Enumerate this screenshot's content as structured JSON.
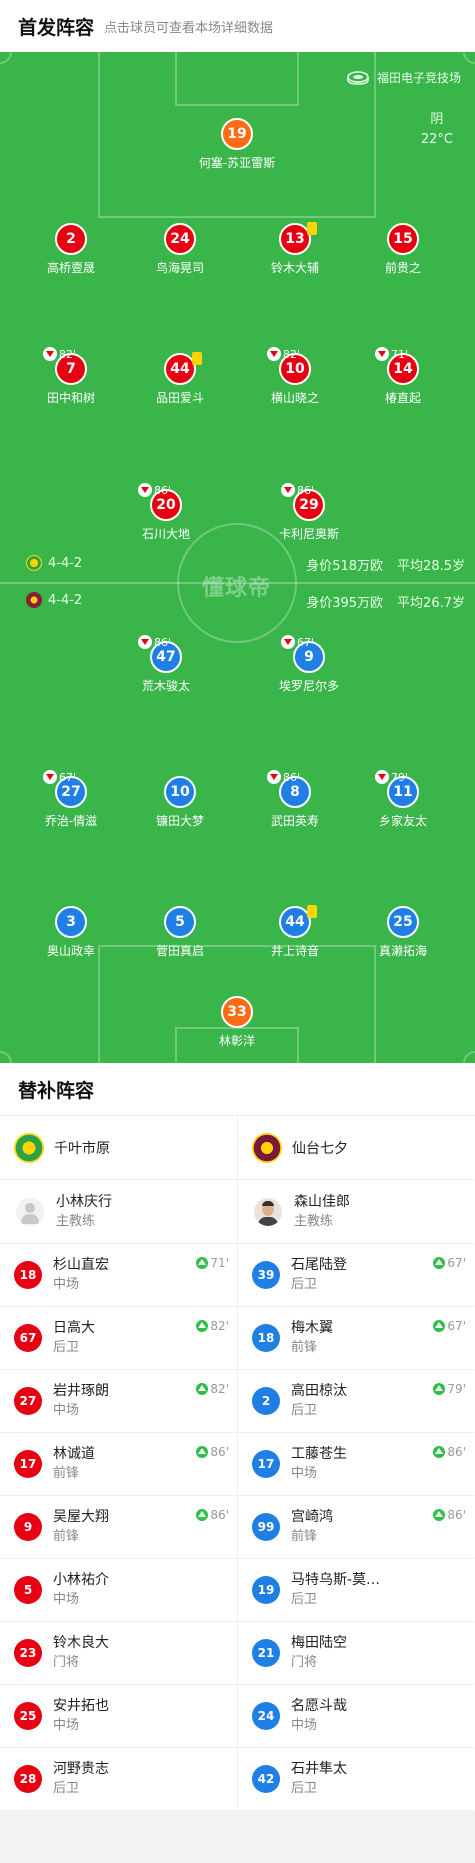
{
  "header": {
    "title": "首发阵容",
    "subtitle": "点击球员可查看本场详细数据"
  },
  "pitch": {
    "venue": "福田电子竞技场",
    "weather": "阴",
    "temperature": "22°C",
    "watermark": "懂球帝",
    "home": {
      "formation": "4-4-2",
      "value": "身价518万欧",
      "avg_age": "平均28.5岁",
      "color": "#e60012"
    },
    "away": {
      "formation": "4-4-2",
      "value": "身价395万欧",
      "avg_age": "平均26.7岁",
      "color": "#1f7fe4"
    },
    "home_players": [
      {
        "num": "19",
        "name": "何塞-苏亚雷斯",
        "gk": true
      },
      {
        "num": "2",
        "name": "高桥壹晟"
      },
      {
        "num": "24",
        "name": "鸟海晃司"
      },
      {
        "num": "13",
        "name": "铃木大辅",
        "yellow": true
      },
      {
        "num": "15",
        "name": "前贵之"
      },
      {
        "num": "7",
        "name": "田中和树",
        "sub": "82'"
      },
      {
        "num": "44",
        "name": "品田爱斗",
        "yellow": true
      },
      {
        "num": "10",
        "name": "横山晓之",
        "sub": "82'"
      },
      {
        "num": "14",
        "name": "椿直起",
        "sub": "71'"
      },
      {
        "num": "20",
        "name": "石川大地",
        "sub": "86'"
      },
      {
        "num": "29",
        "name": "卡利尼奥斯",
        "sub": "86'"
      }
    ],
    "away_players": [
      {
        "num": "47",
        "name": "荒木骏太",
        "sub": "86'"
      },
      {
        "num": "9",
        "name": "埃罗尼尔多",
        "sub": "67'"
      },
      {
        "num": "27",
        "name": "乔治-倩滋",
        "sub": "67'"
      },
      {
        "num": "10",
        "name": "镰田大梦"
      },
      {
        "num": "8",
        "name": "武田英寿",
        "sub": "86'"
      },
      {
        "num": "11",
        "name": "乡家友太",
        "sub": "79'"
      },
      {
        "num": "3",
        "name": "奥山政幸"
      },
      {
        "num": "5",
        "name": "菅田真启"
      },
      {
        "num": "44",
        "name": "井上诗音",
        "yellow": true
      },
      {
        "num": "25",
        "name": "真濑拓海"
      },
      {
        "num": "33",
        "name": "林彰洋",
        "gk": true
      }
    ]
  },
  "bench": {
    "title": "替补阵容",
    "home": {
      "team": "千叶市原",
      "coach": {
        "name": "小林庆行",
        "role": "主教练"
      },
      "players": [
        {
          "num": "18",
          "name": "杉山直宏",
          "pos": "中场",
          "in": "71'"
        },
        {
          "num": "67",
          "name": "日高大",
          "pos": "后卫",
          "in": "82'"
        },
        {
          "num": "27",
          "name": "岩井琢朗",
          "pos": "中场",
          "in": "82'"
        },
        {
          "num": "17",
          "name": "林诚道",
          "pos": "前锋",
          "in": "86'"
        },
        {
          "num": "9",
          "name": "吴屋大翔",
          "pos": "前锋",
          "in": "86'"
        },
        {
          "num": "5",
          "name": "小林祐介",
          "pos": "中场"
        },
        {
          "num": "23",
          "name": "铃木良大",
          "pos": "门将"
        },
        {
          "num": "25",
          "name": "安井拓也",
          "pos": "中场"
        },
        {
          "num": "28",
          "name": "河野贵志",
          "pos": "后卫"
        }
      ]
    },
    "away": {
      "team": "仙台七夕",
      "coach": {
        "name": "森山佳郎",
        "role": "主教练"
      },
      "players": [
        {
          "num": "39",
          "name": "石尾陆登",
          "pos": "后卫",
          "in": "67'"
        },
        {
          "num": "18",
          "name": "梅木翼",
          "pos": "前锋",
          "in": "67'"
        },
        {
          "num": "2",
          "name": "高田椋汰",
          "pos": "后卫",
          "in": "79'"
        },
        {
          "num": "17",
          "name": "工藤苍生",
          "pos": "中场",
          "in": "86'"
        },
        {
          "num": "99",
          "name": "宫崎鸿",
          "pos": "前锋",
          "in": "86'"
        },
        {
          "num": "19",
          "name": "马特乌斯-莫…",
          "pos": "后卫"
        },
        {
          "num": "21",
          "name": "梅田陆空",
          "pos": "门将"
        },
        {
          "num": "24",
          "name": "名愿斗哉",
          "pos": "中场"
        },
        {
          "num": "42",
          "name": "石井隼太",
          "pos": "后卫"
        }
      ]
    }
  }
}
